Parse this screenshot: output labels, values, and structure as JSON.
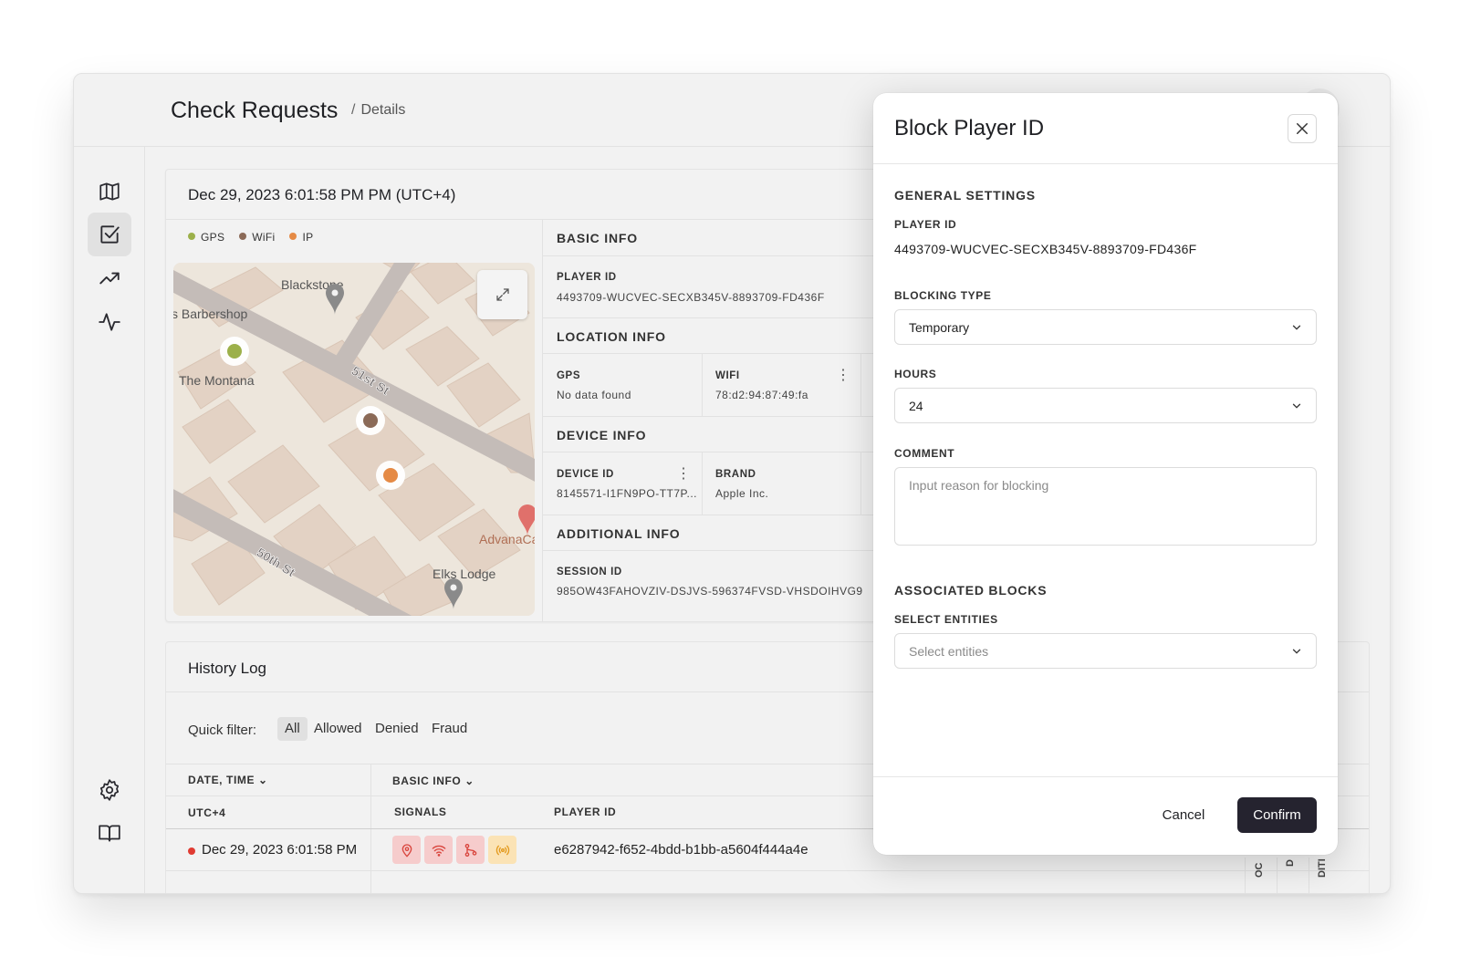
{
  "header": {
    "title": "Check Requests",
    "breadcrumb_sep": "/",
    "breadcrumb": "Details"
  },
  "sidebar": {
    "items": [
      {
        "name": "map",
        "icon": "map-icon"
      },
      {
        "name": "check-requests",
        "icon": "checkbox-icon",
        "active": true
      },
      {
        "name": "trends",
        "icon": "trend-up-icon"
      },
      {
        "name": "activity",
        "icon": "pulse-icon"
      },
      {
        "name": "settings",
        "icon": "gear-icon"
      },
      {
        "name": "docs",
        "icon": "book-icon"
      }
    ]
  },
  "request": {
    "datetime": "Dec 29, 2023 6:01:58 PM PM (UTC+4)",
    "legend": [
      {
        "label": "GPS",
        "color": "#9cb04a"
      },
      {
        "label": "WiFi",
        "color": "#8b6a57"
      },
      {
        "label": "IP",
        "color": "#e58a45"
      }
    ],
    "map": {
      "labels": [
        "Blackstone",
        "s Barbershop",
        "The Montana",
        "51st St",
        "AdvanaCa",
        "Elks Lodge",
        "50th St"
      ],
      "markers": [
        {
          "signal": "GPS",
          "color": "#9cb04a"
        },
        {
          "signal": "WiFi",
          "color": "#8b6a57"
        },
        {
          "signal": "IP",
          "color": "#e58a45"
        }
      ]
    },
    "basic_info": {
      "title": "BASIC INFO",
      "player_id_label": "PLAYER ID",
      "player_id": "4493709-WUCVEC-SECXB345V-8893709-FD436F"
    },
    "location_info": {
      "title": "LOCATION INFO",
      "gps_label": "GPS",
      "gps_value": "No data found",
      "wifi_label": "WIFI",
      "wifi_value": "78:d2:94:87:49:fa"
    },
    "device_info": {
      "title": "DEVICE INFO",
      "device_id_label": "DEVICE ID",
      "device_id": "8145571-I1FN9PO-TT7P...",
      "brand_label": "BRAND",
      "brand": "Apple Inc."
    },
    "additional_info": {
      "title": "ADDITIONAL INFO",
      "session_id_label": "SESSION ID",
      "session_id": "985OW43FAHOVZIV-DSJVS-596374FVSD-VHSDOIHVG9"
    }
  },
  "history": {
    "title": "History Log",
    "quick_filter_label": "Quick filter:",
    "filters": [
      "All",
      "Allowed",
      "Denied",
      "Fraud"
    ],
    "active_filter": "All",
    "group_headers": [
      "DATE, TIME",
      "BASIC INFO"
    ],
    "sub_headers": [
      "UTC+4",
      "SIGNALS",
      "PLAYER ID"
    ],
    "rows": [
      {
        "status_color": "#e03b32",
        "datetime": "Dec 29, 2023 6:01:58 PM",
        "signals": [
          "location-pin-icon",
          "wifi-icon",
          "git-branch-icon",
          "broadcast-icon"
        ],
        "player_id": "e6287942-f652-4bdd-b1bb-a5604f444a4e"
      }
    ],
    "clipped_columns": [
      "OC",
      "D",
      "DITI"
    ]
  },
  "drawer": {
    "title": "Block Player ID",
    "general_settings": "GENERAL SETTINGS",
    "player_id_label": "PLAYER ID",
    "player_id": "4493709-WUCVEC-SECXB345V-8893709-FD436F",
    "blocking_type_label": "BLOCKING TYPE",
    "blocking_type": "Temporary",
    "hours_label": "HOURS",
    "hours": "24",
    "comment_label": "COMMENT",
    "comment_placeholder": "Input reason for blocking",
    "associated_blocks": "ASSOCIATED BLOCKS",
    "select_entities_label": "SELECT ENTITIES",
    "select_entities_placeholder": "Select entities",
    "cancel_label": "Cancel",
    "confirm_label": "Confirm"
  }
}
